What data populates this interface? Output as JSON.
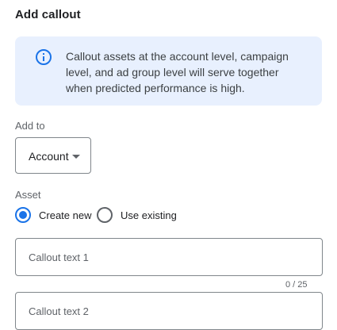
{
  "title": "Add callout",
  "info": {
    "icon": "info-icon",
    "text": "Callout assets at the account level, campaign level, and ad group level will serve together when predicted performance is high."
  },
  "add_to": {
    "label": "Add to",
    "selected": "Account"
  },
  "asset": {
    "label": "Asset",
    "options": [
      {
        "label": "Create new",
        "checked": true
      },
      {
        "label": "Use existing",
        "checked": false
      }
    ]
  },
  "fields": [
    {
      "placeholder": "Callout text 1",
      "value": "",
      "counter": "0 / 25"
    },
    {
      "placeholder": "Callout text 2",
      "value": ""
    }
  ],
  "colors": {
    "accent": "#1a73e8",
    "info_bg": "#e8f0fe"
  }
}
